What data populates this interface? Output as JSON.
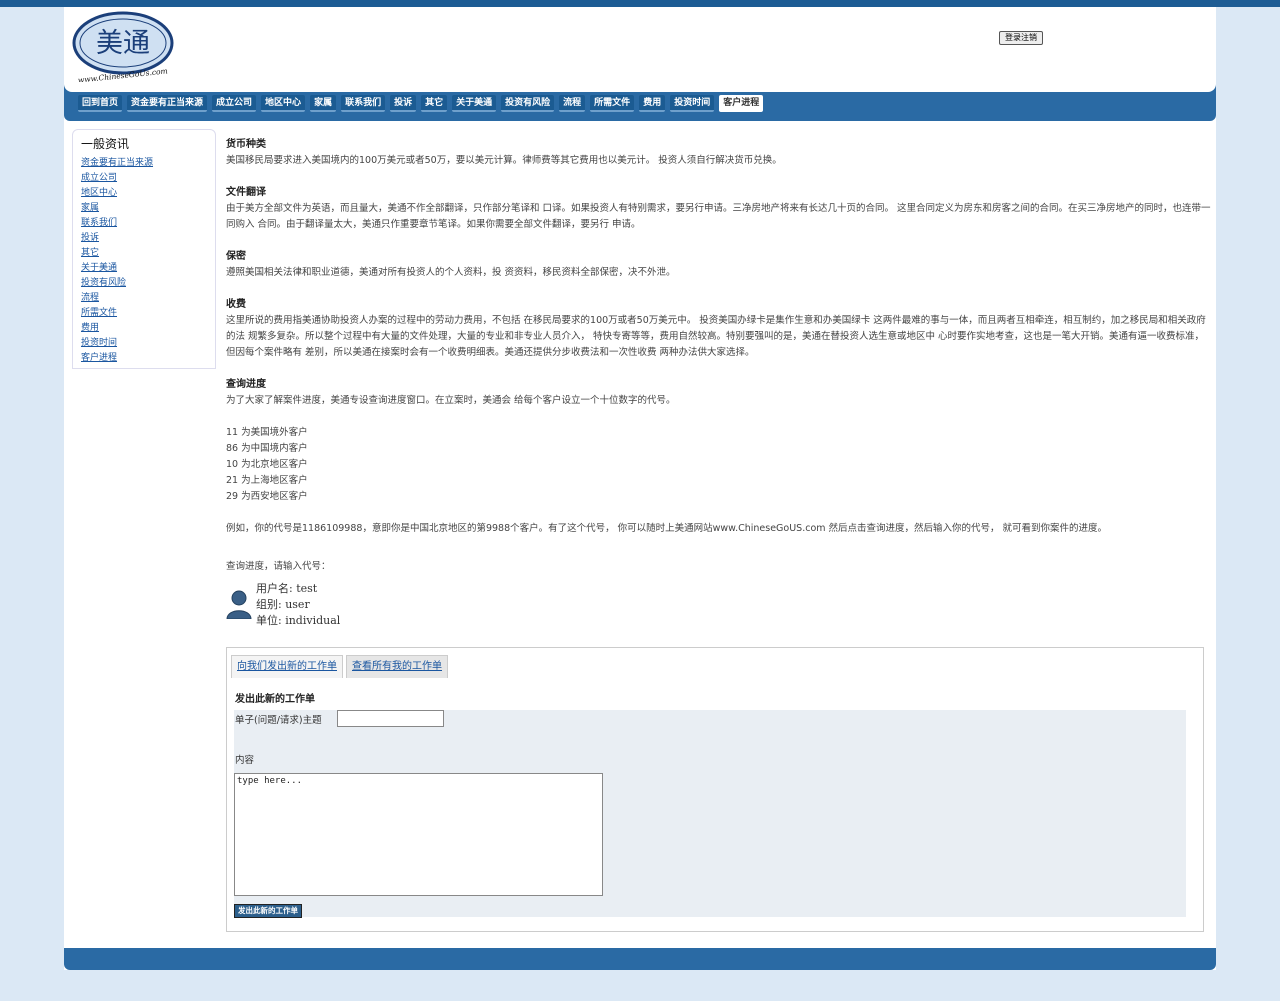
{
  "header": {
    "logo_text": "美通",
    "logo_url_text": "www.ChineseGoUs.com",
    "login_button": "登录注销"
  },
  "nav": [
    {
      "label": "回到首页"
    },
    {
      "label": "资金要有正当来源"
    },
    {
      "label": "成立公司"
    },
    {
      "label": "地区中心"
    },
    {
      "label": "家属"
    },
    {
      "label": "联系我们"
    },
    {
      "label": "投诉"
    },
    {
      "label": "其它"
    },
    {
      "label": "关于美通"
    },
    {
      "label": "投资有风险"
    },
    {
      "label": "流程"
    },
    {
      "label": "所需文件"
    },
    {
      "label": "费用"
    },
    {
      "label": "投资时间"
    },
    {
      "label": "客户进程"
    }
  ],
  "sidebar": {
    "title": "一般资讯",
    "links": [
      "资金要有正当来源",
      "成立公司",
      "地区中心",
      "家属",
      "联系我们",
      "投诉",
      "其它",
      "关于美通",
      "投资有风险",
      "流程",
      "所需文件",
      "费用",
      "投资时间",
      "客户进程"
    ]
  },
  "content": {
    "sections": [
      {
        "title": "货币种类",
        "text": "美国移民局要求进入美国境内的100万美元或者50万，要以美元计算。律师费等其它费用也以美元计。 投资人须自行解决货币兑换。"
      },
      {
        "title": "文件翻译",
        "text": "由于美方全部文件为英语，而且量大，美通不作全部翻译，只作部分笔译和 口译。如果投资人有特别需求，要另行申请。三净房地产将来有长达几十页的合同。 这里合同定义为房东和房客之间的合同。在买三净房地产的同时，也连带一同购入 合同。由于翻译量太大，美通只作重要章节笔译。如果你需要全部文件翻译，要另行 申请。"
      },
      {
        "title": "保密",
        "text": "遵照美国相关法律和职业道德，美通对所有投资人的个人资料，投 资资料，移民资料全部保密，决不外泄。"
      },
      {
        "title": "收费",
        "text": "这里所说的费用指美通协助投资人办案的过程中的劳动力费用，不包括 在移民局要求的100万或者50万美元中。 投资美国办绿卡是集作生意和办美国绿卡 这两件最难的事与一体，而且两者互相牵连，相互制约，加之移民局和相关政府的法 规繁多复杂。所以整个过程中有大量的文件处理，大量的专业和非专业人员介入， 特快专寄等等，费用自然较高。特别要强叫的是，美通在替投资人选生意或地区中 心时要作实地考查，这也是一笔大开销。美通有逼一收费标准，但因每个案件略有 差别，所以美通在接案时会有一个收费明细表。美通还提供分步收费法和一次性收费 两种办法供大家选择。"
      },
      {
        "title": "查询进度",
        "text": "为了大家了解案件进度，美通专设查询进度窗口。在立案时，美通会 给每个客户设立一个十位数字的代号。"
      }
    ],
    "codes": [
      "11 为美国境外客户",
      "86 为中国境内客户",
      "10 为北京地区客户",
      "21 为上海地区客户",
      "29 为西安地区客户"
    ],
    "example": "例如，你的代号是1186109988，意即你是中国北京地区的第9988个客户。有了这个代号， 你可以随时上美通网站www.ChineseGoUS.com 然后点击查询进度，然后输入你的代号， 就可看到你案件的进度。",
    "query_prompt": "查询进度，请输入代号：",
    "user": {
      "username": "用户名: test",
      "group": "组别: user",
      "unit": "单位: individual"
    }
  },
  "ticket": {
    "tab_new": "向我们发出新的工作单",
    "tab_all": "查看所有我的工作单",
    "form_title": "发出此新的工作单",
    "subject_label": "单子(问题/请求)主题",
    "subject_value": "",
    "content_label": "内容",
    "content_value": "type here...",
    "submit_label": "发出此新的工作单"
  },
  "colors": {
    "nav_bg": "#2a6aa4",
    "tab_bg": "#1b5b92",
    "page_bg": "#dbe8f5",
    "link": "#1a56a0"
  }
}
